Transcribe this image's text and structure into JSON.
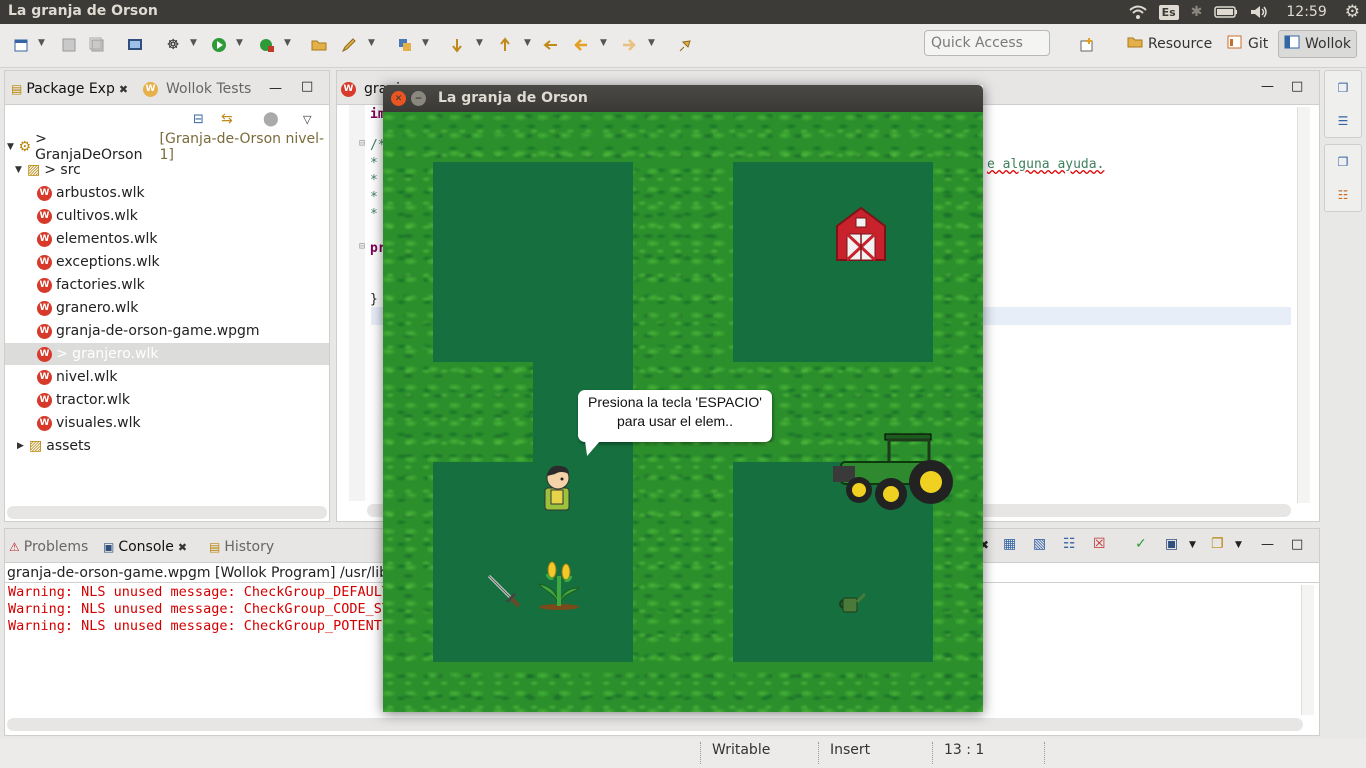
{
  "panel": {
    "window_title": "La granja de Orson",
    "keyboard_layout": "Es",
    "clock": "12:59",
    "icons": [
      "wifi-icon",
      "bluetooth-icon",
      "battery-icon",
      "volume-icon",
      "gear-icon"
    ]
  },
  "toolbar": {
    "quick_access_placeholder": "Quick Access",
    "perspectives": [
      {
        "label": "Resource",
        "icon": "resource-perspective-icon"
      },
      {
        "label": "Git",
        "icon": "git-perspective-icon"
      },
      {
        "label": "Wollok",
        "icon": "wollok-perspective-icon",
        "active": true
      }
    ]
  },
  "package_explorer": {
    "tabs": [
      {
        "label": "Package Exp",
        "active": true
      },
      {
        "label": "Wollok Tests",
        "active": false
      }
    ],
    "project": {
      "label": "> GranjaDeOrson",
      "decoration": "[Granja-de-Orson nivel-1]"
    },
    "src_label": "> src",
    "files": [
      "arbustos.wlk",
      "cultivos.wlk",
      "elementos.wlk",
      "exceptions.wlk",
      "factories.wlk",
      "granero.wlk",
      "granja-de-orson-game.wpgm",
      "> granjero.wlk",
      "nivel.wlk",
      "tractor.wlk",
      "visuales.wlk"
    ],
    "selected_index": 7,
    "assets_label": "assets"
  },
  "editor": {
    "tab_label": "granj",
    "lines": [
      {
        "text": "im"
      },
      {
        "text": "/*"
      },
      {
        "text": " *"
      },
      {
        "text": " *"
      },
      {
        "text": " *"
      },
      {
        "text": " *"
      },
      {
        "text": "pr"
      },
      {
        "text": "}"
      }
    ],
    "visible_comment_tail": "e alguna ayuda."
  },
  "console": {
    "tabs": [
      {
        "label": "Problems",
        "active": false
      },
      {
        "label": "Console",
        "active": true
      },
      {
        "label": "History",
        "active": false
      }
    ],
    "process_label": "granja-de-orson-game.wpgm [Wollok Program] /usr/lib/j",
    "lines": [
      "Warning: NLS unused message: CheckGroup_DEFAULT",
      "Warning: NLS unused message: CheckGroup_CODE_ST",
      "Warning: NLS unused message: CheckGroup_POTENTI"
    ]
  },
  "status_bar": {
    "writable": "Writable",
    "insert_mode": "Insert",
    "cursor_position": "13 : 1"
  },
  "game": {
    "title": "La granja de Orson",
    "speech_line1": "Presiona la tecla 'ESPACIO'",
    "speech_line2": "para usar el elem..",
    "sprites": [
      "barn-icon",
      "tractor-icon",
      "farmer-icon",
      "corn-plant-icon",
      "sword-icon",
      "watering-can-icon"
    ],
    "colors": {
      "grass": "#2b8f2b",
      "field": "#156f3f"
    }
  }
}
